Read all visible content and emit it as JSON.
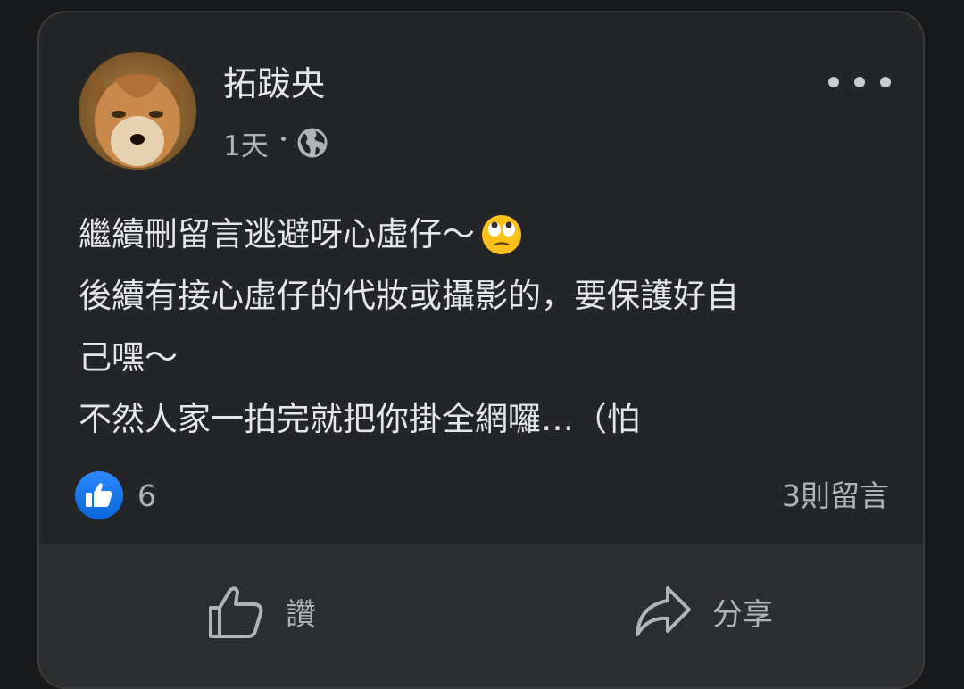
{
  "post": {
    "author": "拓跋央",
    "time": "1天",
    "privacy_icon": "globe-icon",
    "more_icon": "more-icon",
    "lines": [
      "繼續刪留言逃避呀心虛仔～",
      "後續有接心虛仔的代妝或攝影的，要保護好自",
      "己嘿～",
      "不然人家一拍完就把你掛全網囉…（怕"
    ],
    "emoji": "face-with-rolling-eyes-emoji"
  },
  "stats": {
    "reaction_icon": "like-reaction-icon",
    "like_count": "6",
    "comment_count": "3則留言"
  },
  "actions": {
    "like_label": "讚",
    "share_label": "分享"
  },
  "colors": {
    "background": "#18191a",
    "card": "#242526",
    "action_bar": "#2c2d2f",
    "text_primary": "#e4e6eb",
    "text_secondary": "#b0b3b8",
    "like_blue": "#1b74e4"
  }
}
